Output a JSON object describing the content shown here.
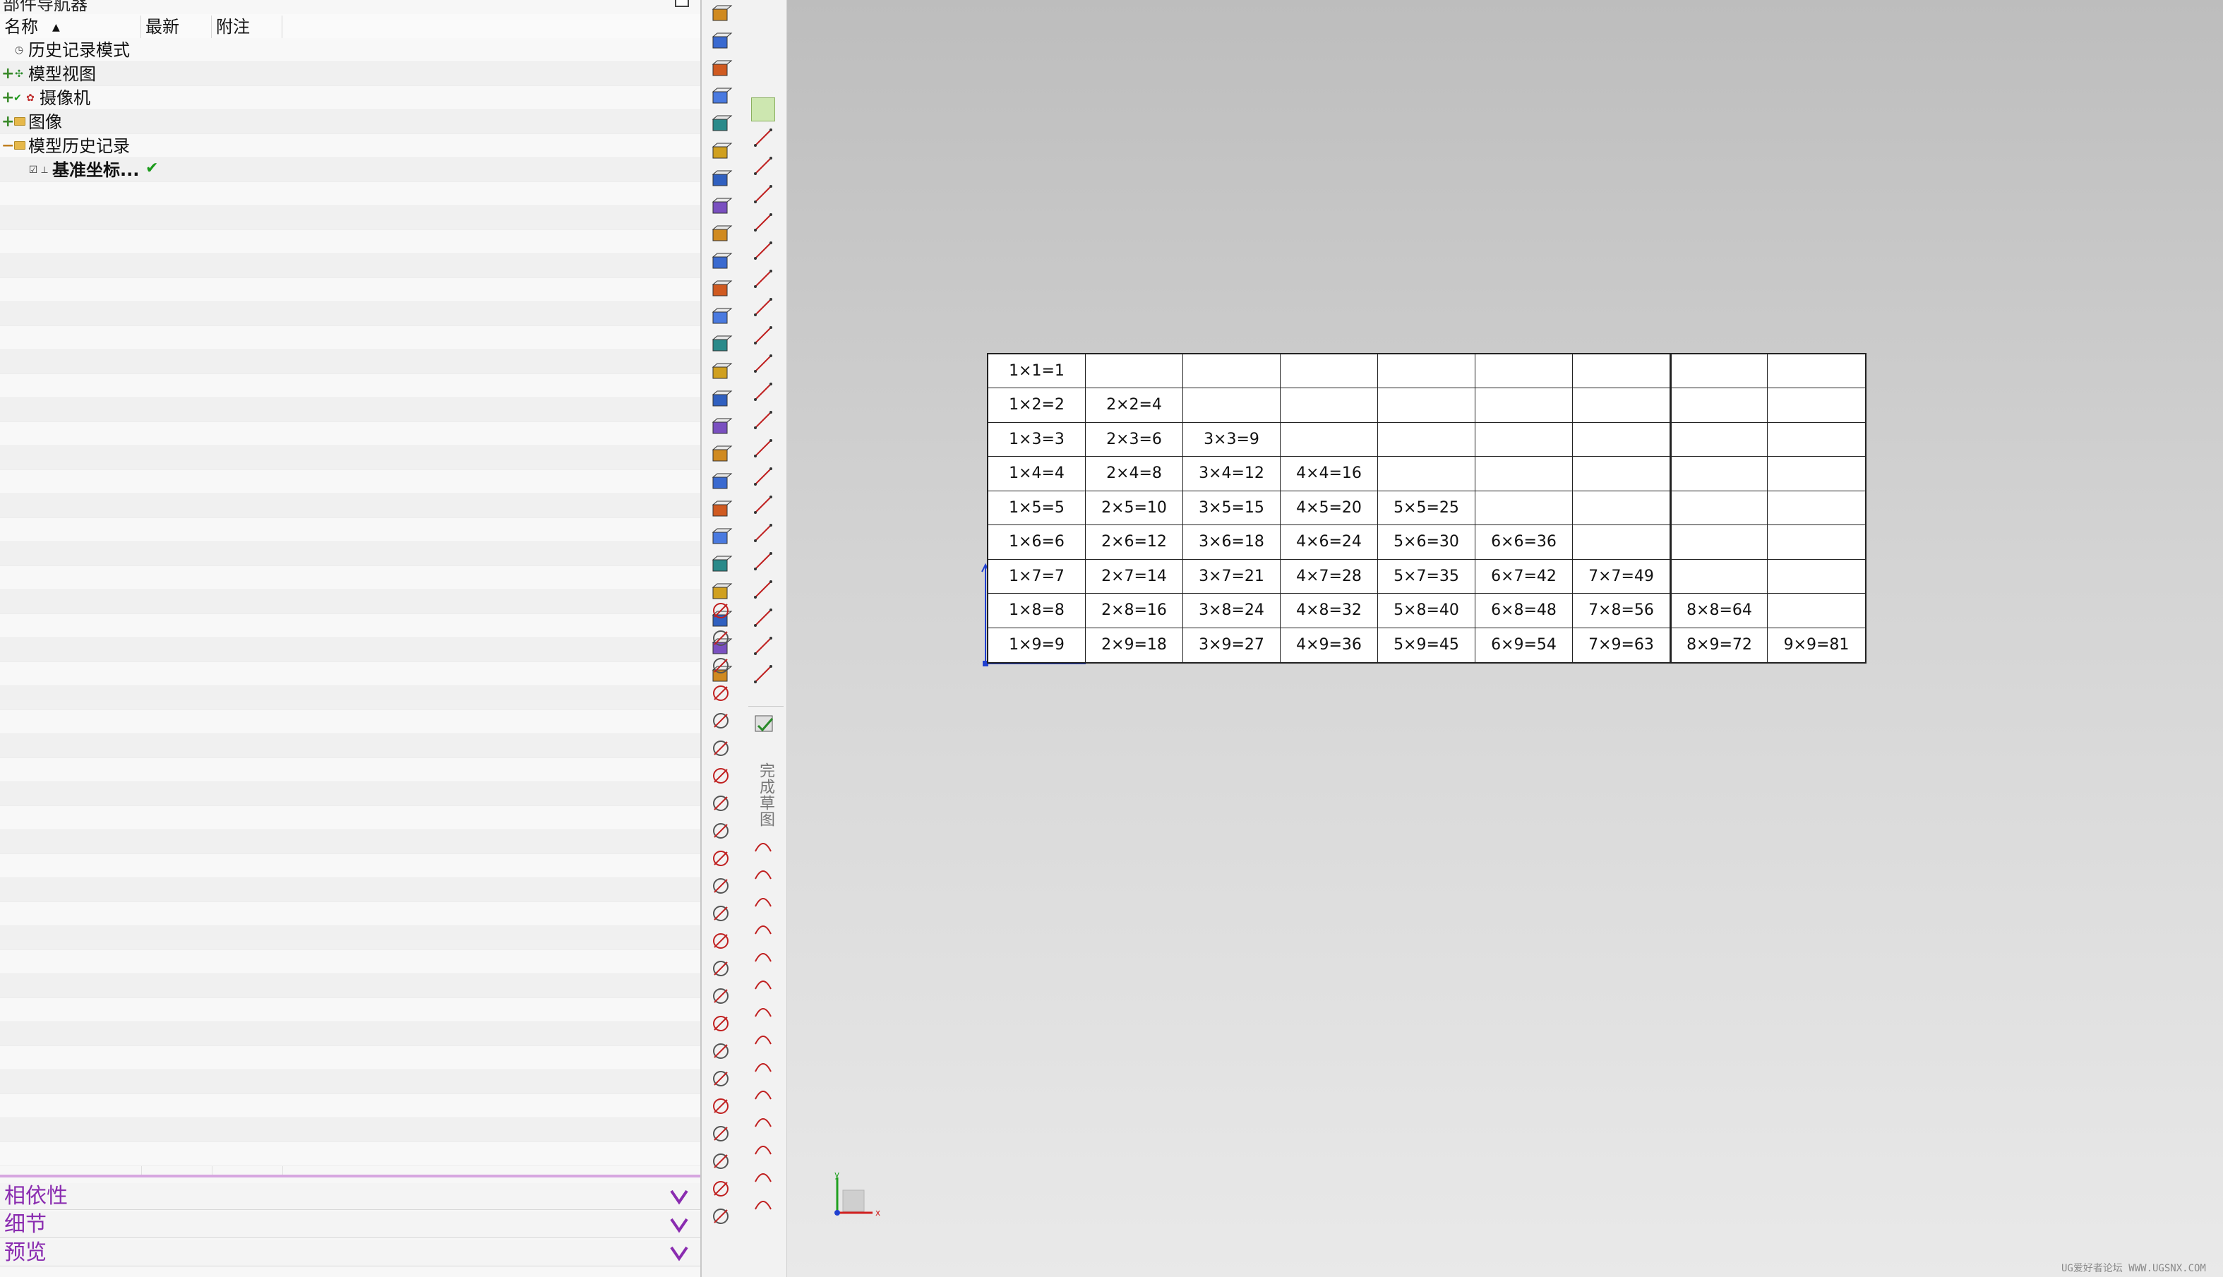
{
  "navigator": {
    "title": "部件导航器",
    "columns": [
      "名称",
      "最新",
      "附注"
    ],
    "nodes": [
      {
        "label": "历史记录模式",
        "expander": "",
        "bold": false
      },
      {
        "label": "模型视图",
        "expander": "+",
        "bold": false
      },
      {
        "label": "摄像机",
        "expander": "+",
        "bold": false
      },
      {
        "label": "图像",
        "expander": "+",
        "bold": false
      },
      {
        "label": "模型历史记录",
        "expander": "−",
        "bold": false
      },
      {
        "label": "基准坐标...",
        "expander": "",
        "bold": true,
        "latest_check": "✔"
      }
    ],
    "sections": [
      {
        "label": "相依性"
      },
      {
        "label": "细节"
      },
      {
        "label": "预览"
      }
    ]
  },
  "toolbar": {
    "finish_sketch_label": "完成草图"
  },
  "table": {
    "rows": [
      [
        "1×1=1",
        "",
        "",
        "",
        "",
        "",
        "",
        "",
        ""
      ],
      [
        "1×2=2",
        "2×2=4",
        "",
        "",
        "",
        "",
        "",
        "",
        ""
      ],
      [
        "1×3=3",
        "2×3=6",
        "3×3=9",
        "",
        "",
        "",
        "",
        "",
        ""
      ],
      [
        "1×4=4",
        "2×4=8",
        "3×4=12",
        "4×4=16",
        "",
        "",
        "",
        "",
        ""
      ],
      [
        "1×5=5",
        "2×5=10",
        "3×5=15",
        "4×5=20",
        "5×5=25",
        "",
        "",
        "",
        ""
      ],
      [
        "1×6=6",
        "2×6=12",
        "3×6=18",
        "4×6=24",
        "5×6=30",
        "6×6=36",
        "",
        "",
        ""
      ],
      [
        "1×7=7",
        "2×7=14",
        "3×7=21",
        "4×7=28",
        "5×7=35",
        "6×7=42",
        "7×7=49",
        "",
        ""
      ],
      [
        "1×8=8",
        "2×8=16",
        "3×8=24",
        "4×8=32",
        "5×8=40",
        "6×8=48",
        "7×8=56",
        "8×8=64",
        ""
      ],
      [
        "1×9=9",
        "2×9=18",
        "3×9=27",
        "4×9=36",
        "5×9=45",
        "6×9=54",
        "7×9=63",
        "8×9=72",
        "9×9=81"
      ]
    ]
  },
  "watermark": "UG爱好者论坛 WWW.UGSNX.COM",
  "colors": {
    "section_text": "#8a2cb0",
    "check_green": "#1a9a1a",
    "axis_x": "#d02020",
    "axis_y": "#20a020",
    "axis_z": "#2040d0"
  }
}
